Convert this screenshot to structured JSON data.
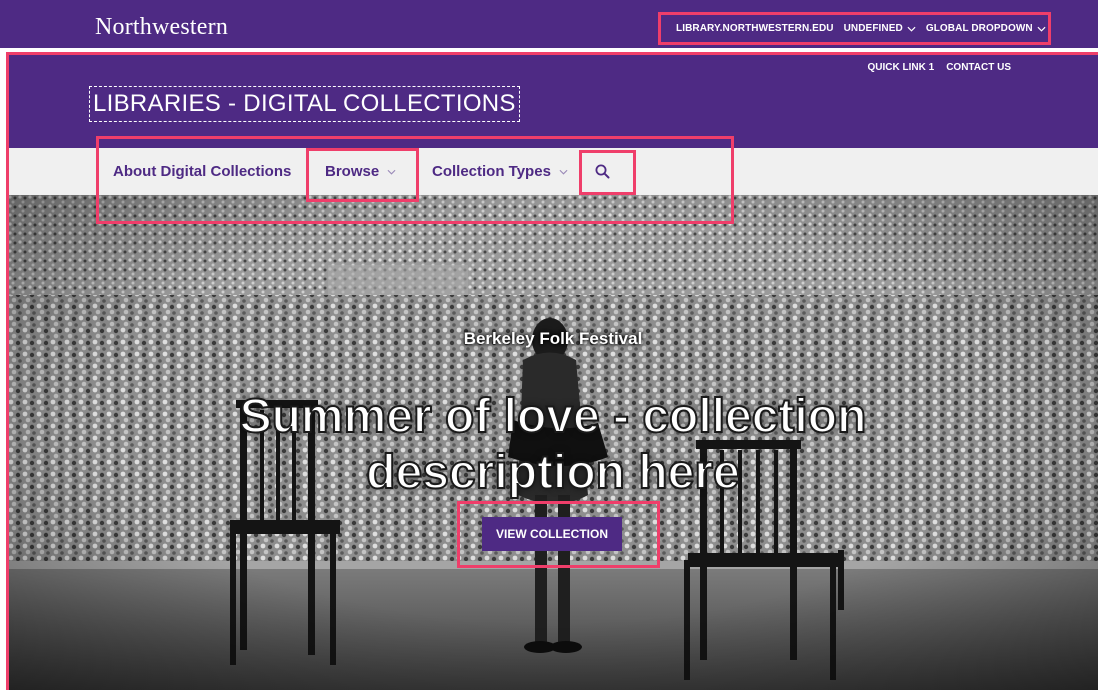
{
  "utility_bar": {
    "brand": "Northwestern",
    "links": [
      {
        "label": "LIBRARY.NORTHWESTERN.EDU",
        "dropdown": false
      },
      {
        "label": "UNDEFINED",
        "dropdown": true
      },
      {
        "label": "GLOBAL DROPDOWN",
        "dropdown": true
      }
    ]
  },
  "header": {
    "quick_links": [
      "QUICK LINK 1",
      "CONTACT US"
    ],
    "site_title": "LIBRARIES - DIGITAL COLLECTIONS"
  },
  "nav": {
    "items": [
      {
        "label": "About Digital Collections",
        "dropdown": false
      },
      {
        "label": "Browse",
        "dropdown": true
      },
      {
        "label": "Collection Types",
        "dropdown": true
      }
    ],
    "search_icon": "search-icon"
  },
  "hero": {
    "eyebrow": "Berkeley Folk Festival",
    "title_line1": "Summer of love - collection",
    "title_line2": "description here",
    "cta_label": "VIEW COLLECTION"
  },
  "colors": {
    "brand_purple": "#4e2a84",
    "annotation_pink": "#ef3e6a",
    "nav_background": "#f0f0f0"
  }
}
